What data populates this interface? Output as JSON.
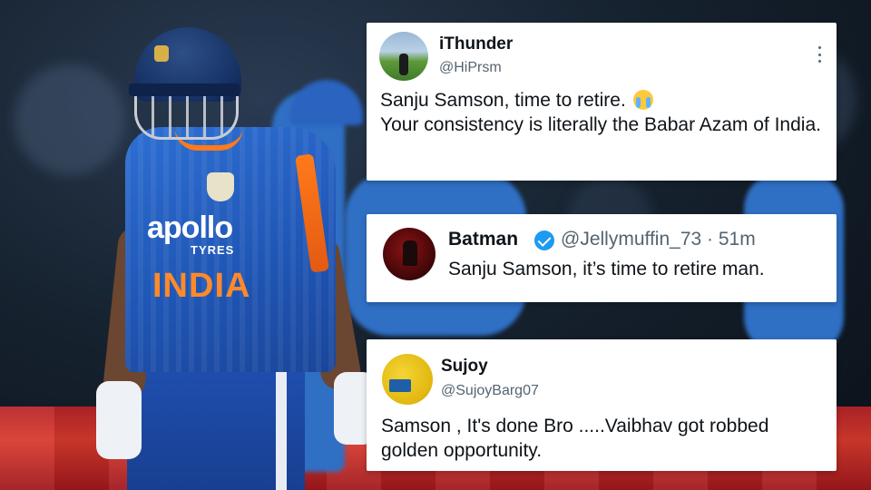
{
  "tweets": [
    {
      "name": "iThunder",
      "handle": "@HiPrsm",
      "avatar_icon": "stadium-avatar-icon",
      "text_line1": "Sanju Samson, time to retire.",
      "text_emoji": "loudly-crying-face-emoji",
      "text_line2": "Your consistency is literally the Babar Azam of India."
    },
    {
      "name": "Batman",
      "verified": true,
      "handle_time": "@Jellymuffin_73 · 51m",
      "avatar_icon": "batman-avatar-icon",
      "text": "Sanju Samson, it’s time to retire man."
    },
    {
      "name": "Sujoy",
      "handle": "@SujoyBarg07",
      "avatar_icon": "yellow-avatar-icon",
      "text": "Samson , It's done Bro .....Vaibhav got robbed golden opportunity."
    }
  ],
  "photo": {
    "sponsor": "apollo",
    "sponsor_sub": "TYRES",
    "team": "INDIA"
  },
  "colors": {
    "card_bg": "#ffffff",
    "text": "#0f1419",
    "muted": "#536471",
    "verified": "#1d9bf0",
    "jersey": "#1f55b4",
    "accent_orange": "#ff7a1a"
  }
}
